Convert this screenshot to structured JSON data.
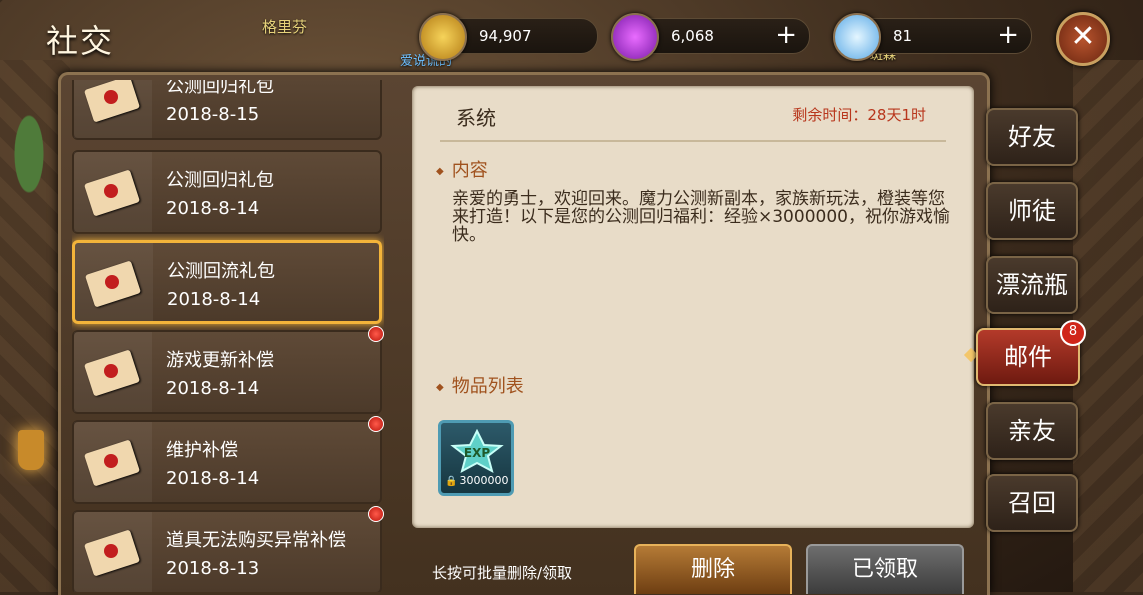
{
  "title": "社交",
  "scene": {
    "npc_name": "格里芬",
    "npc_sub": "爱说谎的",
    "npc_sub2": "斑森"
  },
  "currencies": [
    {
      "name": "gold",
      "value": "94,907",
      "icon": "gold-coin-icon"
    },
    {
      "name": "gem",
      "value": "6,068",
      "icon": "purple-gem-icon",
      "plus": "+"
    },
    {
      "name": "diamond",
      "value": "81",
      "icon": "diamond-icon",
      "plus": "+"
    }
  ],
  "close_label": "✕",
  "mail_list": [
    {
      "title": "公测回归礼包",
      "date": "2018-8-15",
      "unread": false
    },
    {
      "title": "公测回归礼包",
      "date": "2018-8-14",
      "unread": false
    },
    {
      "title": "公测回流礼包",
      "date": "2018-8-14",
      "unread": false,
      "selected": true
    },
    {
      "title": "游戏更新补偿",
      "date": "2018-8-14",
      "unread": true
    },
    {
      "title": "维护补偿",
      "date": "2018-8-14",
      "unread": true
    },
    {
      "title": "道具无法购买异常补偿",
      "date": "2018-8-13",
      "unread": true
    }
  ],
  "detail": {
    "sender": "系统",
    "remain": "剩余时间：28天1时",
    "content_label": "内容",
    "content": "亲爱的勇士，欢迎回来。魔力公测新副本，家族新玩法，橙装等您来打造！以下是您的公测回归福利：经验×3000000，祝你游戏愉快。",
    "items_label": "物品列表",
    "items": [
      {
        "icon": "exp-star-icon",
        "label": "EXP",
        "qty": "3000000"
      }
    ]
  },
  "bottom": {
    "hint": "长按可批量删除/领取",
    "delete": "删除",
    "claimed": "已领取"
  },
  "tabs": [
    {
      "label": "好友"
    },
    {
      "label": "师徒"
    },
    {
      "label": "漂流瓶"
    },
    {
      "label": "邮件",
      "active": true,
      "badge": "8"
    },
    {
      "label": "亲友"
    },
    {
      "label": "召回"
    }
  ]
}
